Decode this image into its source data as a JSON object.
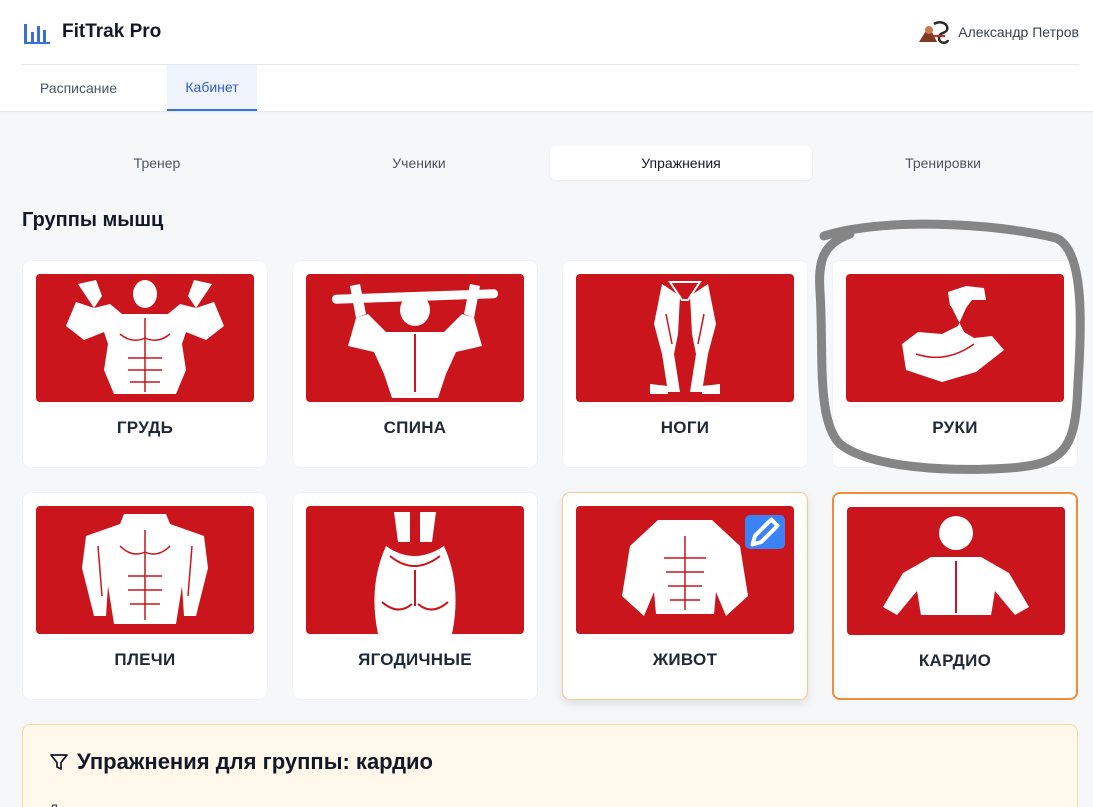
{
  "app": {
    "title": "FitTrak Pro"
  },
  "user": {
    "name": "Александр Петров"
  },
  "nav": {
    "tabs": [
      {
        "label": "Расписание"
      },
      {
        "label": "Кабинет"
      }
    ]
  },
  "subtabs": [
    {
      "label": "Тренер"
    },
    {
      "label": "Ученики"
    },
    {
      "label": "Упражнения"
    },
    {
      "label": "Тренировки"
    }
  ],
  "section": {
    "title": "Группы мышц"
  },
  "muscle_groups": [
    {
      "label": "ГРУДЬ"
    },
    {
      "label": "СПИНА"
    },
    {
      "label": "НОГИ"
    },
    {
      "label": "РУКИ"
    },
    {
      "label": "ПЛЕЧИ"
    },
    {
      "label": "ЯГОДИЧНЫЕ"
    },
    {
      "label": "ЖИВОТ"
    },
    {
      "label": "КАРДИО"
    }
  ],
  "exercises_panel": {
    "title": "Упражнения для группы: кардио",
    "subtitle": "Д"
  },
  "colors": {
    "accent": "#3b6fd8",
    "card_image_bg": "#c9151b",
    "selected_border": "#f28c38",
    "edit_button": "#3b82f6"
  }
}
